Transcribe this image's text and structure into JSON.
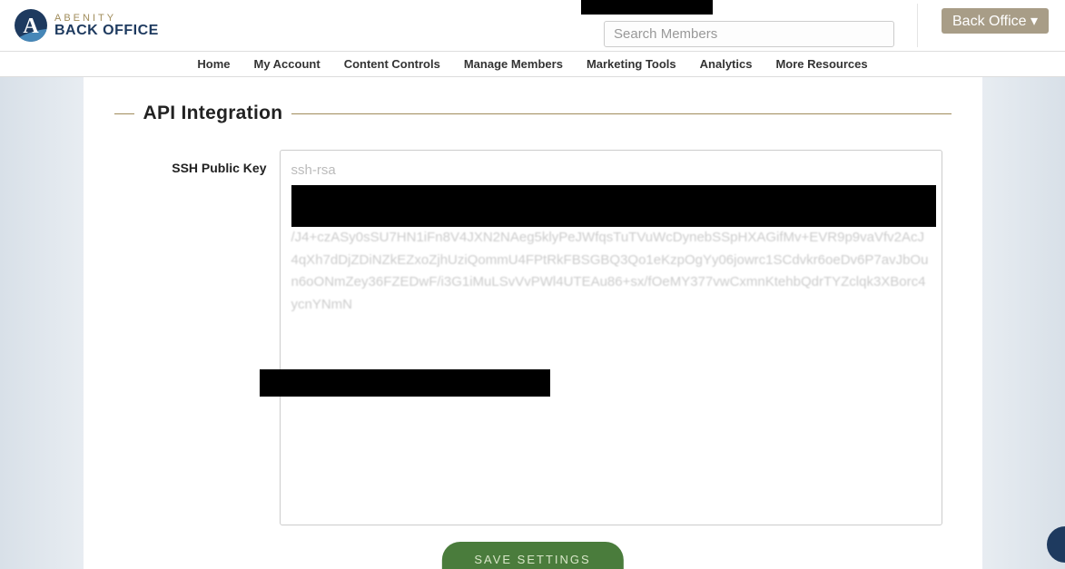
{
  "header": {
    "brand_top": "ABENITY",
    "brand_bottom": "BACK OFFICE",
    "search_placeholder": "Search Members",
    "back_office_label": "Back Office ▾"
  },
  "nav": {
    "items": [
      "Home",
      "My Account",
      "Content Controls",
      "Manage Members",
      "Marketing Tools",
      "Analytics",
      "More Resources"
    ]
  },
  "section": {
    "title": "API Integration",
    "field_label": "SSH Public Key",
    "ssh_prefix": "ssh-rsa",
    "ssh_body": "/J4+czASy0sSU7HN1iFn8V4JXN2NAeg5klyPeJWfqsTuTVuWcDynebSSpHXAGifMv+EVR9p9vaVfv2AcJ4qXh7dDjZDiNZkEZxoZjhUziQommU4FPtRkFBSGBQ3Qo1eKzpOgYy06jowrc1SCdvkr6oeDv6P7avJbOun6oONmZey36FZEDwF/i3G1iMuLSvVvPWl4UTEAu86+sx/fOeMY377vwCxmnKtehbQdrTYZclqk3XBorc4ycnYNmN"
  },
  "save_button": "SAVE SETTINGS"
}
